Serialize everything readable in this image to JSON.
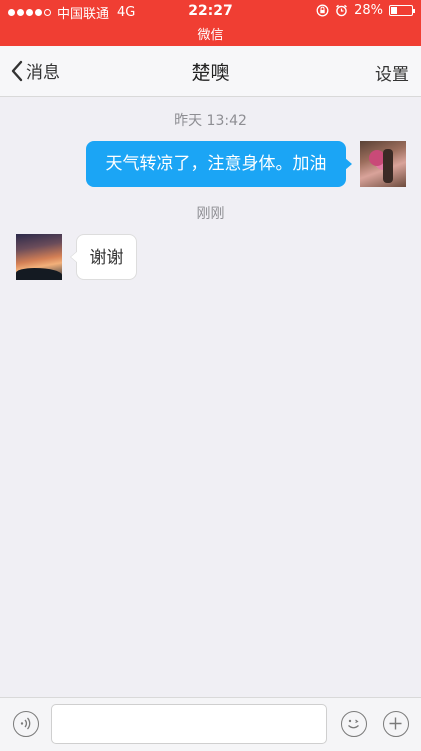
{
  "status_bar": {
    "carrier": "中国联通",
    "network": "4G",
    "time": "22:27",
    "app_name": "微信",
    "battery_percent": "28%",
    "battery_level": 0.28,
    "signal_bars": 4,
    "background_color": "#f03e33"
  },
  "nav": {
    "back_label": "消息",
    "title": "楚噢",
    "settings_label": "设置"
  },
  "chat": {
    "timestamp1": "昨天 13:42",
    "message_out": "天气转凉了，注意身体。加油",
    "timestamp2": "刚刚",
    "message_in": "谢谢"
  },
  "colors": {
    "outgoing_bubble": "#1ba5f5",
    "incoming_bubble": "#ffffff",
    "chat_background": "#f0eff4"
  },
  "icons": {
    "voice": "voice-icon",
    "emoji": "emoji-icon",
    "add": "add-icon"
  }
}
